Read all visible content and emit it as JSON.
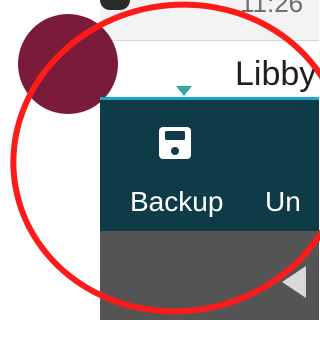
{
  "status_bar": {
    "time": "11:26"
  },
  "chat": {
    "contact_name": "Libby"
  },
  "action_bar": {
    "backup_label": "Backup",
    "undo_label": "Un",
    "backup_icon": "floppy-disk-icon"
  },
  "nav_bar": {
    "back_icon": "back-triangle-icon"
  },
  "annotation": {
    "color": "#ff1a1a"
  }
}
